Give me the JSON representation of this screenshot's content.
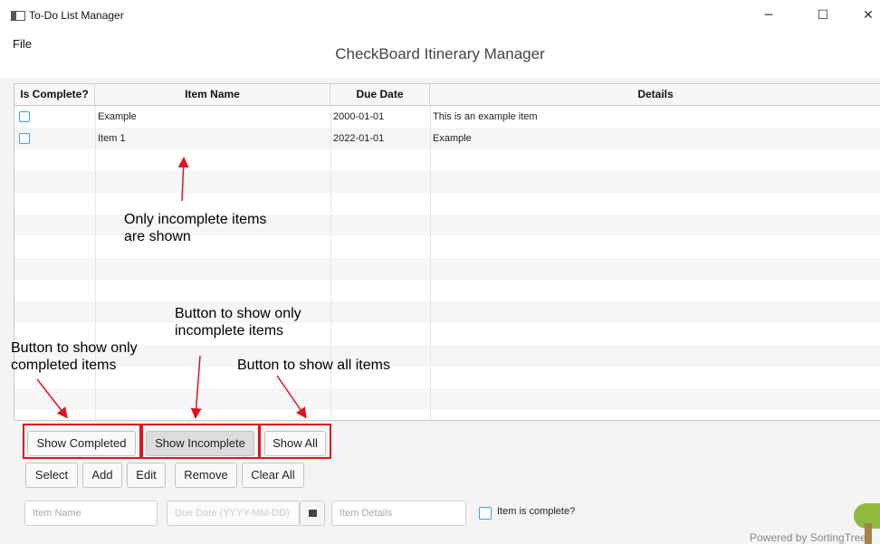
{
  "window": {
    "title": "To-Do List Manager",
    "controls": [
      "─",
      "☐",
      "✕"
    ]
  },
  "menu": {
    "file": "File"
  },
  "app_title": "CheckBoard Itinerary Manager",
  "table": {
    "headers": [
      "Is Complete?",
      "Item Name",
      "Due Date",
      "Details"
    ],
    "rows": [
      {
        "complete": false,
        "name": "Example",
        "due": "2000-01-01",
        "details": "This is an example item"
      },
      {
        "complete": false,
        "name": "Item 1",
        "due": "2022-01-01",
        "details": "Example"
      }
    ]
  },
  "annotations": {
    "incomplete_shown": [
      "Only incomplete items",
      "are shown"
    ],
    "show_incomplete_btn": [
      "Button to show only",
      "incomplete items"
    ],
    "show_completed_btn": [
      "Button to show only",
      "completed items"
    ],
    "show_all_btn": "Button to show all items",
    "highlight_color": "#e0141e"
  },
  "filter_buttons": {
    "show_completed": "Show Completed",
    "show_incomplete": "Show Incomplete",
    "show_all": "Show All"
  },
  "action_buttons": {
    "select": "Select",
    "add": "Add",
    "edit": "Edit",
    "remove": "Remove",
    "clear_all": "Clear All"
  },
  "form": {
    "item_name_placeholder": "Item Name",
    "due_date_placeholder": "Due Date (YYYY-MM-DD)",
    "item_details_placeholder": "Item Details",
    "complete_label": "Item is complete?",
    "calendar_icon": "calendar-icon"
  },
  "footer": {
    "powered_by": "Powered by SortingTree"
  },
  "colors": {
    "accent": "#3f9fd6",
    "annotation": "#e0141e"
  }
}
